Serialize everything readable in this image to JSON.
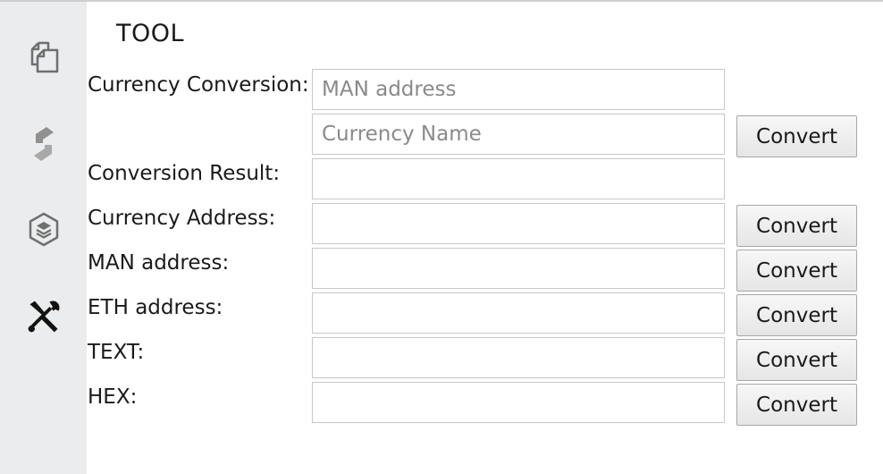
{
  "sidebar": {
    "icons": [
      "copy-icon",
      "swap-icon",
      "layers-icon",
      "tools-icon"
    ]
  },
  "page": {
    "title": "TOOL"
  },
  "form": {
    "currency_conversion_label": "Currency Conversion:",
    "man_address_placeholder": "MAN address",
    "currency_name_placeholder": "Currency Name",
    "conversion_result_label": "Conversion Result:",
    "currency_address_label": "Currency Address:",
    "man_address_label": "MAN address:",
    "eth_address_label": "ETH address:",
    "text_label": "TEXT:",
    "hex_label": "HEX:",
    "convert_label": "Convert"
  }
}
